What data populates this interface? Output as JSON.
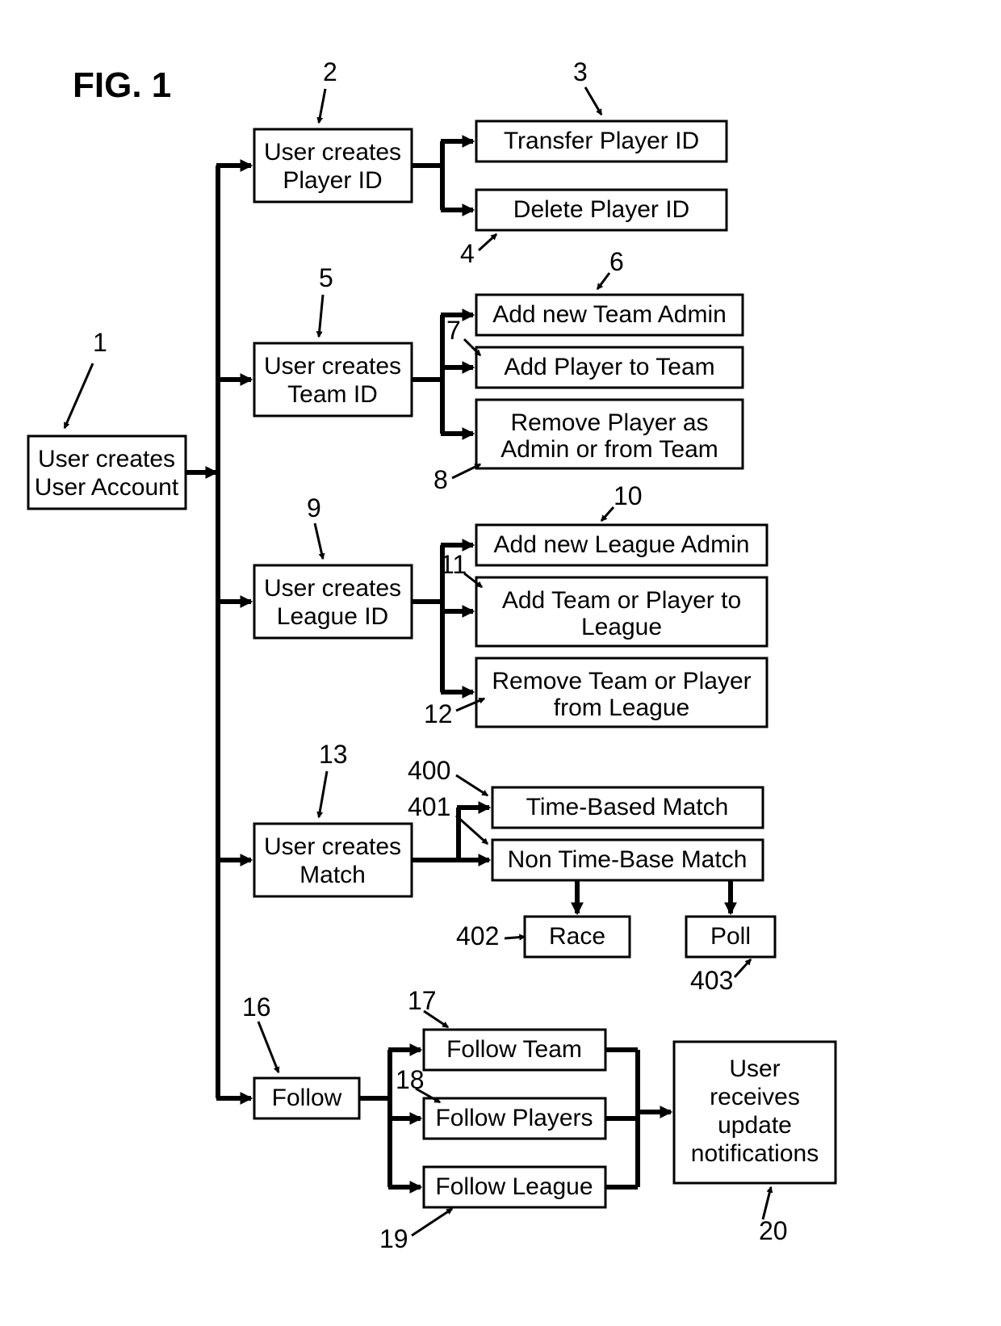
{
  "title": "FIG. 1",
  "boxes": {
    "b1": {
      "lines": [
        "User creates",
        "User Account"
      ]
    },
    "b2": {
      "lines": [
        "User creates",
        "Player ID"
      ]
    },
    "b3": {
      "lines": [
        "Transfer Player ID"
      ]
    },
    "b4": {
      "lines": [
        "Delete Player ID"
      ]
    },
    "b5": {
      "lines": [
        "User creates",
        "Team ID"
      ]
    },
    "b6": {
      "lines": [
        "Add new Team Admin"
      ]
    },
    "b7": {
      "lines": [
        "Add Player to Team"
      ]
    },
    "b8": {
      "lines": [
        "Remove Player as",
        "Admin or from Team"
      ]
    },
    "b9": {
      "lines": [
        "User creates",
        "League ID"
      ]
    },
    "b10": {
      "lines": [
        "Add new League Admin"
      ]
    },
    "b11": {
      "lines": [
        "Add Team or Player to",
        "League"
      ]
    },
    "b12": {
      "lines": [
        "Remove Team or Player",
        "from League"
      ]
    },
    "b13": {
      "lines": [
        "User creates",
        "Match"
      ]
    },
    "b400": {
      "lines": [
        "Time-Based Match"
      ]
    },
    "b401": {
      "lines": [
        "Non Time-Base Match"
      ]
    },
    "b402": {
      "lines": [
        "Race"
      ]
    },
    "b403": {
      "lines": [
        "Poll"
      ]
    },
    "b16": {
      "lines": [
        "Follow"
      ]
    },
    "b17": {
      "lines": [
        "Follow Team"
      ]
    },
    "b18": {
      "lines": [
        "Follow Players"
      ]
    },
    "b19": {
      "lines": [
        "Follow League"
      ]
    },
    "b20": {
      "lines": [
        "User",
        "receives",
        "update",
        "notifications"
      ]
    }
  },
  "refs": {
    "r1": "1",
    "r2": "2",
    "r3": "3",
    "r4": "4",
    "r5": "5",
    "r6": "6",
    "r7": "7",
    "r8": "8",
    "r9": "9",
    "r10": "10",
    "r11": "11",
    "r12": "12",
    "r13": "13",
    "r16": "16",
    "r17": "17",
    "r18": "18",
    "r19": "19",
    "r20": "20",
    "r400": "400",
    "r401": "401",
    "r402": "402",
    "r403": "403"
  }
}
